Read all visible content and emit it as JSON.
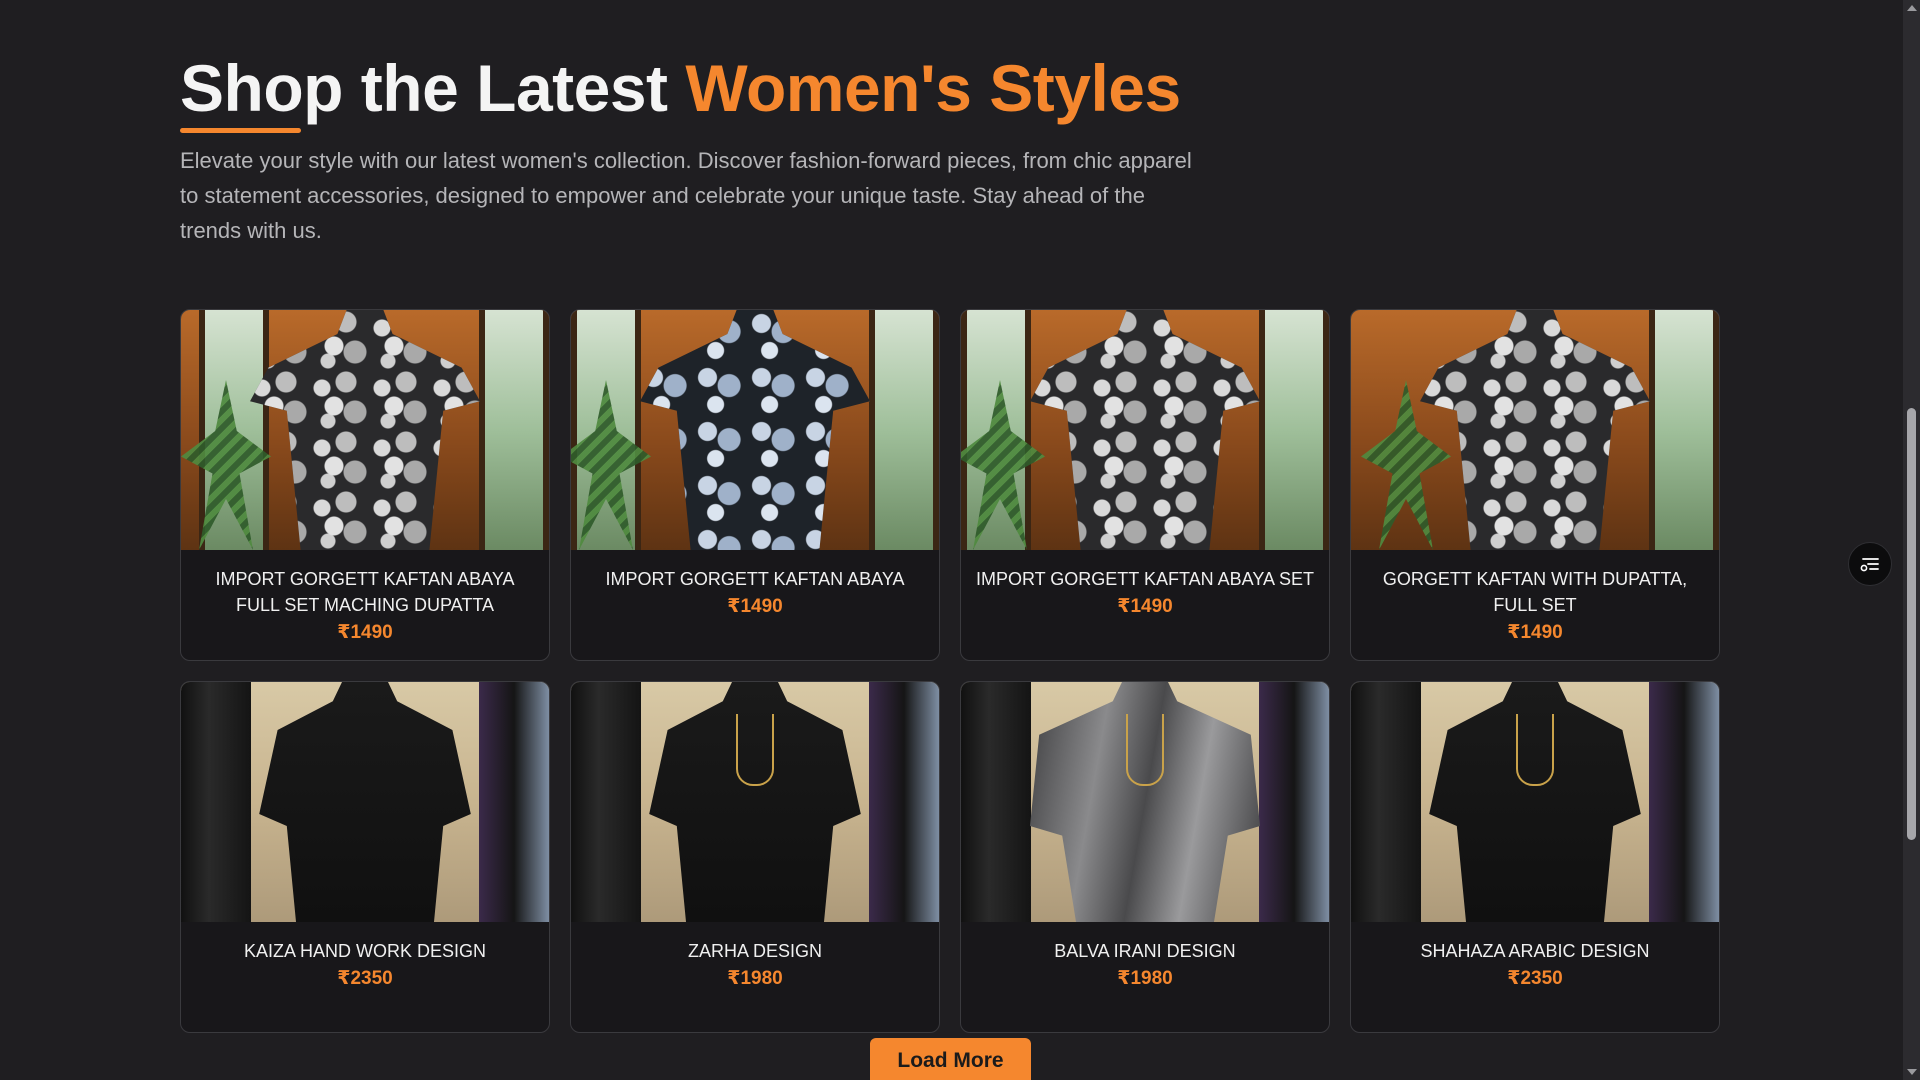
{
  "section": {
    "heading_main": "Shop the Latest ",
    "heading_accent": "Women's Styles",
    "intro": "Elevate your style with our latest women's collection. Discover fashion-forward pieces, from chic apparel to statement accessories, designed to empower and celebrate your unique taste. Stay ahead of the trends with us."
  },
  "products": [
    {
      "name": "IMPORT GORGETT KAFTAN ABAYA FULL SET MACHING DUPATTA",
      "price": "₹1490"
    },
    {
      "name": "IMPORT GORGETT KAFTAN ABAYA",
      "price": "₹1490"
    },
    {
      "name": "IMPORT GORGETT KAFTAN ABAYA SET",
      "price": "₹1490"
    },
    {
      "name": "GORGETT KAFTAN WITH DUPATTA, FULL SET",
      "price": "₹1490"
    },
    {
      "name": "KAIZA HAND WORK DESIGN",
      "price": "₹2350"
    },
    {
      "name": "ZARHA DESIGN",
      "price": "₹1980"
    },
    {
      "name": "BALVA IRANI DESIGN",
      "price": "₹1980"
    },
    {
      "name": "SHAHAZA ARABIC DESIGN",
      "price": "₹2350"
    }
  ],
  "actions": {
    "load_more": "Load More",
    "filter_icon": "filter-icon"
  },
  "colors": {
    "background": "#1f1e21",
    "accent": "#f5872e",
    "card_background": "#18171a"
  }
}
